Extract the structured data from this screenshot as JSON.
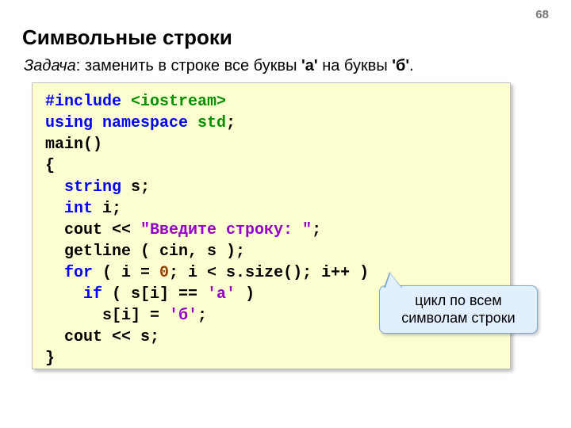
{
  "page_number": "68",
  "title": "Символьные строки",
  "task": {
    "prefix_italic": "Задача",
    "body": ": заменить в строке все буквы ",
    "lit_a": "'а'",
    "mid": " на буквы ",
    "lit_b": "'б'",
    "suffix": "."
  },
  "code": {
    "l1_a": "#include ",
    "l1_b": "<iostream>",
    "l2_a": "using namespace ",
    "l2_b": "std",
    "l2_c": ";",
    "l3": "main()",
    "l4": "{",
    "l5_a": "  string ",
    "l5_b": "s;",
    "l6_a": "  int ",
    "l6_b": "i;",
    "l7_a": "  cout << ",
    "l7_b": "\"Введите строку: \"",
    "l7_c": ";",
    "l8": "  getline ( cin, s );",
    "l9_a": "  for",
    "l9_b": " ( i = ",
    "l9_c": "0",
    "l9_d": "; i < s.size(); i++ )",
    "l10_a": "    if",
    "l10_b": " ( s[i] == ",
    "l10_c": "'а'",
    "l10_d": " )",
    "l11_a": "      s[i] = ",
    "l11_b": "'б'",
    "l11_c": ";",
    "l12": "  cout << s;",
    "l13": "}"
  },
  "callout": "цикл по всем символам строки"
}
